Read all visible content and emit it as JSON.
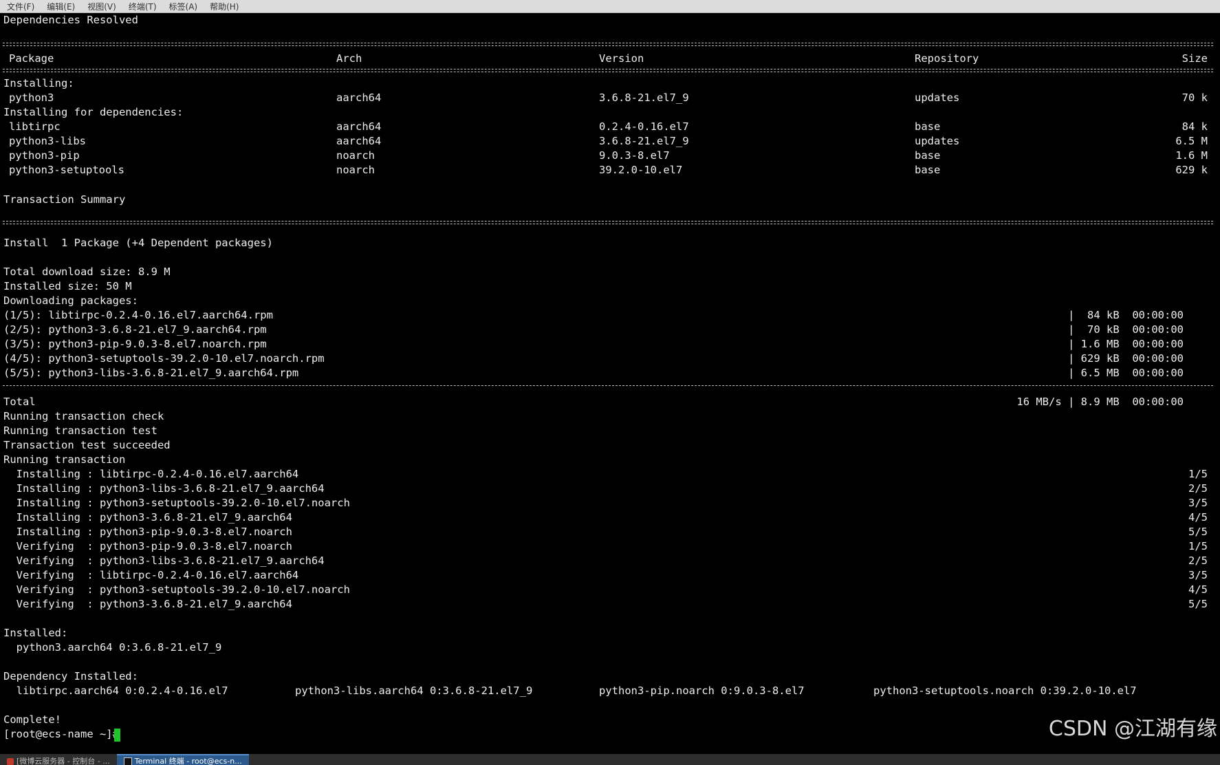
{
  "menubar": {
    "items": [
      "文件(F)",
      "编辑(E)",
      "视图(V)",
      "终端(T)",
      "标签(A)",
      "帮助(H)"
    ]
  },
  "terminal": {
    "deps_resolved": "Dependencies Resolved",
    "separator_double": "==================================================================================================================================================================================================================",
    "separator_single": "--------------------------------------------------------------------------------------------------------------------------------------------------------------------------------------------------------------------------",
    "table_header": {
      "package": "Package",
      "arch": "Arch",
      "version": "Version",
      "repository": "Repository",
      "size": "Size"
    },
    "installing_label": "Installing:",
    "installing_rows": [
      {
        "package": "python3",
        "arch": "aarch64",
        "version": "3.6.8-21.el7_9",
        "repository": "updates",
        "size": "70 k"
      }
    ],
    "deps_label": "Installing for dependencies:",
    "dep_rows": [
      {
        "package": "libtirpc",
        "arch": "aarch64",
        "version": "0.2.4-0.16.el7",
        "repository": "base",
        "size": "84 k"
      },
      {
        "package": "python3-libs",
        "arch": "aarch64",
        "version": "3.6.8-21.el7_9",
        "repository": "updates",
        "size": "6.5 M"
      },
      {
        "package": "python3-pip",
        "arch": "noarch",
        "version": "9.0.3-8.el7",
        "repository": "base",
        "size": "1.6 M"
      },
      {
        "package": "python3-setuptools",
        "arch": "noarch",
        "version": "39.2.0-10.el7",
        "repository": "base",
        "size": "629 k"
      }
    ],
    "transaction_summary": "Transaction Summary",
    "install_line": "Install  1 Package (+4 Dependent packages)",
    "total_download": "Total download size: 8.9 M",
    "installed_size": "Installed size: 50 M",
    "downloading": "Downloading packages:",
    "downloads": [
      {
        "name": "(1/5): libtirpc-0.2.4-0.16.el7.aarch64.rpm",
        "stats": "|  84 kB  00:00:00"
      },
      {
        "name": "(2/5): python3-3.6.8-21.el7_9.aarch64.rpm",
        "stats": "|  70 kB  00:00:00"
      },
      {
        "name": "(3/5): python3-pip-9.0.3-8.el7.noarch.rpm",
        "stats": "| 1.6 MB  00:00:00"
      },
      {
        "name": "(4/5): python3-setuptools-39.2.0-10.el7.noarch.rpm",
        "stats": "| 629 kB  00:00:00"
      },
      {
        "name": "(5/5): python3-libs-3.6.8-21.el7_9.aarch64.rpm",
        "stats": "| 6.5 MB  00:00:00"
      }
    ],
    "total_label": "Total",
    "total_stats": "16 MB/s | 8.9 MB  00:00:00",
    "running_check": "Running transaction check",
    "running_test": "Running transaction test",
    "test_succeeded": "Transaction test succeeded",
    "running_transaction": "Running transaction",
    "steps": [
      {
        "action": "  Installing : libtirpc-0.2.4-0.16.el7.aarch64",
        "count": "1/5"
      },
      {
        "action": "  Installing : python3-libs-3.6.8-21.el7_9.aarch64",
        "count": "2/5"
      },
      {
        "action": "  Installing : python3-setuptools-39.2.0-10.el7.noarch",
        "count": "3/5"
      },
      {
        "action": "  Installing : python3-3.6.8-21.el7_9.aarch64",
        "count": "4/5"
      },
      {
        "action": "  Installing : python3-pip-9.0.3-8.el7.noarch",
        "count": "5/5"
      },
      {
        "action": "  Verifying  : python3-pip-9.0.3-8.el7.noarch",
        "count": "1/5"
      },
      {
        "action": "  Verifying  : python3-libs-3.6.8-21.el7_9.aarch64",
        "count": "2/5"
      },
      {
        "action": "  Verifying  : libtirpc-0.2.4-0.16.el7.aarch64",
        "count": "3/5"
      },
      {
        "action": "  Verifying  : python3-setuptools-39.2.0-10.el7.noarch",
        "count": "4/5"
      },
      {
        "action": "  Verifying  : python3-3.6.8-21.el7_9.aarch64",
        "count": "5/5"
      }
    ],
    "installed_label": "Installed:",
    "installed_pkg": "  python3.aarch64 0:3.6.8-21.el7_9",
    "dep_installed_label": "Dependency Installed:",
    "dep_installed": [
      "  libtirpc.aarch64 0:0.2.4-0.16.el7",
      "python3-libs.aarch64 0:3.6.8-21.el7_9",
      "python3-pip.noarch 0:9.0.3-8.el7",
      "python3-setuptools.noarch 0:39.2.0-10.el7"
    ],
    "complete": "Complete!",
    "prompt": "[root@ecs-name ~]# "
  },
  "watermark": "CSDN @江湖有缘",
  "taskbar": {
    "items": [
      "[微博云服务器 - 控制台 - ...",
      "Terminal 终端 - root@ecs-n..."
    ]
  },
  "colors": {
    "background": "#000000",
    "text": "#ededed",
    "cursor": "#22c22a"
  }
}
